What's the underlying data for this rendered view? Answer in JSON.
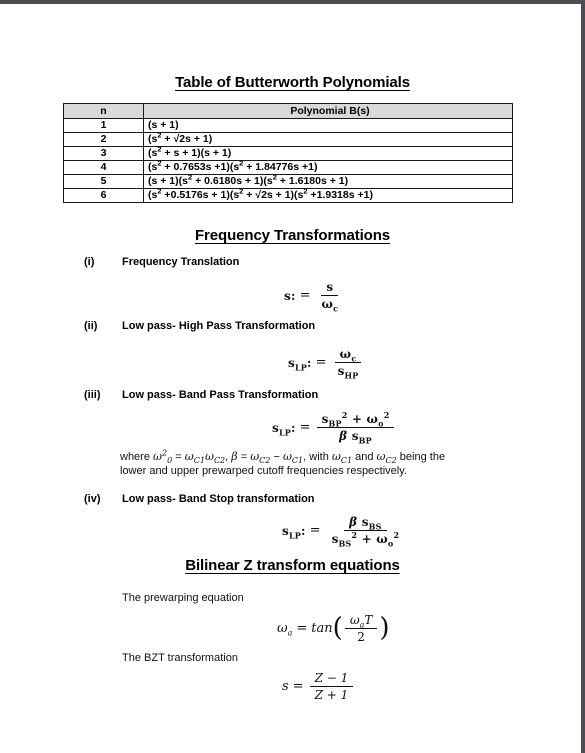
{
  "document": {
    "title": "Table of Butterworth Polynomials",
    "sections": [
      {
        "heading": "Frequency Transformations"
      },
      {
        "heading": "Bilinear Z transform equations"
      }
    ]
  },
  "table": {
    "headers": [
      "n",
      "Polynomial B(s)"
    ],
    "rows": [
      {
        "n": "1",
        "poly": "(s + 1)"
      },
      {
        "n": "2",
        "poly": "(s2 + √2s + 1)"
      },
      {
        "n": "3",
        "poly": "(s2 + s + 1)(s + 1)"
      },
      {
        "n": "4",
        "poly": "(s2 + 0.7653s +1)(s2 + 1.84776s +1)"
      },
      {
        "n": "5",
        "poly": "(s + 1)(s2 + 0.6180s + 1)(s2 + 1.6180s + 1)"
      },
      {
        "n": "6",
        "poly": "(s2 +0.5176s + 1)(s2 + √2s + 1)(s2 +1.9318s +1)"
      }
    ],
    "header_fill": "#d9d9d9",
    "border_color": "#1a1a1a"
  },
  "transformations": [
    {
      "num": "(i)",
      "label": "Frequency Translation"
    },
    {
      "num": "(ii)",
      "label": "Low pass- High Pass Transformation"
    },
    {
      "num": "(iii)",
      "label": "Low pass- Band Pass Transformation"
    },
    {
      "num": "(iv)",
      "label": "Low pass- Band Stop transformation"
    }
  ],
  "equations": {
    "freq_translation": {
      "lhs": "s:",
      "rel": "=",
      "numerator": "s",
      "denominator": "ωc"
    },
    "low_high": {
      "lhs": "sLP:",
      "rel": "=",
      "numerator": "ωc",
      "denominator": "sHP"
    },
    "low_band_pass": {
      "lhs": "sLP:",
      "rel": "=",
      "numerator": "s²BP + ω²o",
      "denominator": "β sBP"
    },
    "low_band_stop": {
      "lhs": "sLP:",
      "rel": "=",
      "numerator": "β sBS",
      "denominator": "s²BS + ω²o"
    },
    "prewarping": {
      "lhs": "ωa",
      "rel": "=",
      "fn": "tan",
      "numerator": "ωaT",
      "denominator": "2"
    },
    "bzt": {
      "lhs": "s",
      "rel": "=",
      "numerator": "Z − 1",
      "denominator": "Z + 1"
    }
  },
  "notes": {
    "band_pass_where_line1": "where ω²₀ = ωC1ωC2, β = ωC2 − ωC1, with ωC1 and ωC2 being the",
    "band_pass_where_line2": "lower and upper prewarped cutoff frequencies respectively."
  },
  "bzt_labels": {
    "prewarping": "The prewarping equation",
    "transformation": "The BZT transformation"
  },
  "symbols": {
    "omega": "ω",
    "beta": "β",
    "sqrt": "√",
    "minus": "−"
  },
  "colors": {
    "page_background": "#ffffff",
    "text": "#000000",
    "page_border": "#4a4f55",
    "table_header_fill": "#d9d9d9"
  }
}
